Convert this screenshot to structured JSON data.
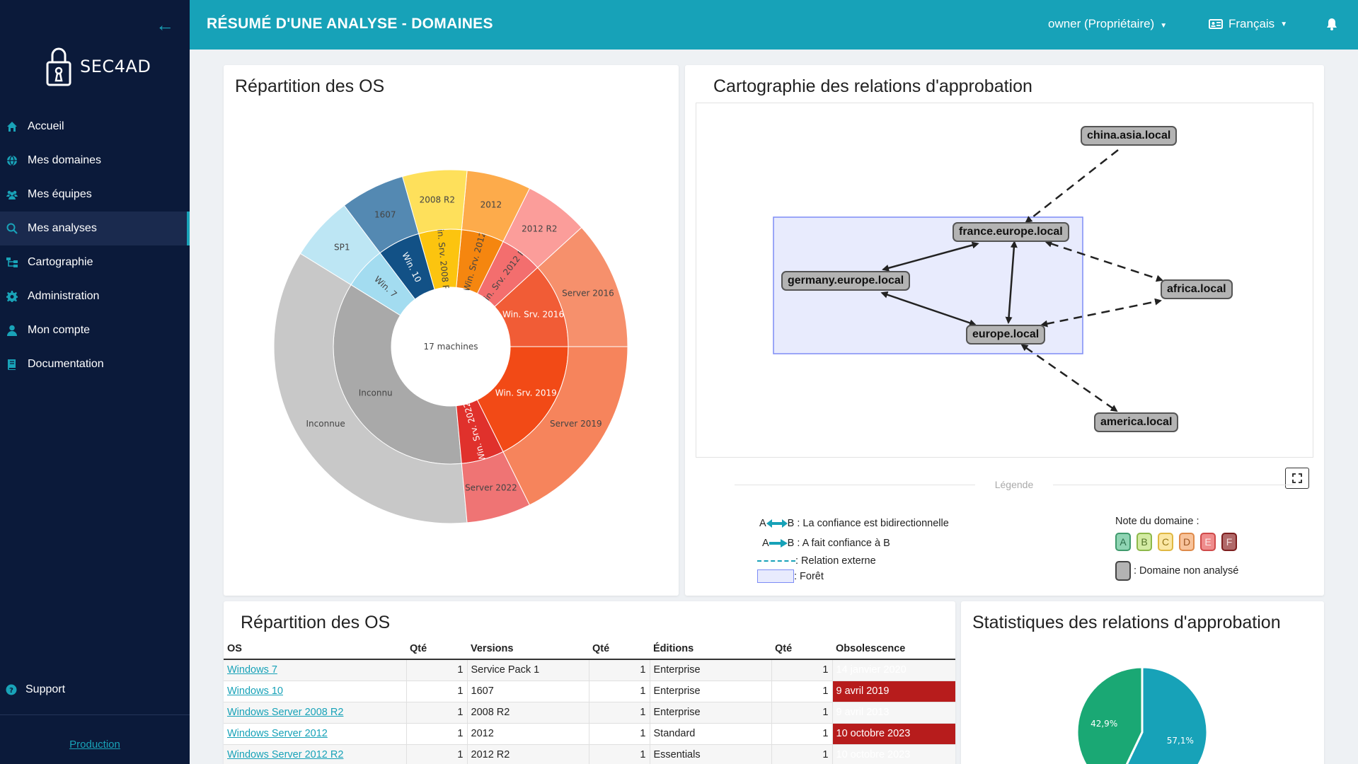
{
  "app": {
    "brand": "SEC4AD",
    "page_title": "RÉSUMÉ D'UNE ANALYSE - DOMAINES",
    "user_menu": "owner (Propriétaire)",
    "language": "Français"
  },
  "sidebar": {
    "items": [
      {
        "label": "Accueil",
        "icon": "home-icon"
      },
      {
        "label": "Mes domaines",
        "icon": "globe-icon"
      },
      {
        "label": "Mes équipes",
        "icon": "users-icon"
      },
      {
        "label": "Mes analyses",
        "icon": "search-icon"
      },
      {
        "label": "Cartographie",
        "icon": "sitemap-icon"
      },
      {
        "label": "Administration",
        "icon": "gear-icon"
      },
      {
        "label": "Mon compte",
        "icon": "user-icon"
      },
      {
        "label": "Documentation",
        "icon": "book-icon"
      }
    ],
    "active_index": 3,
    "support": "Support",
    "environment": "Production"
  },
  "os_chart": {
    "title": "Répartition des OS",
    "center_label": "17 machines",
    "chart_data": {
      "type": "sunburst",
      "total": 17,
      "inner": [
        {
          "label": "Win. Srv. 2016",
          "value": 2,
          "color": "#f15c36"
        },
        {
          "label": "Win. Srv. 2012 R2",
          "value": 1,
          "color": "#f36e6e"
        },
        {
          "label": "Win. Srv. 2012",
          "value": 1,
          "color": "#f5860f"
        },
        {
          "label": "Win. Srv. 2008 R2",
          "value": 1,
          "color": "#fcc40f"
        },
        {
          "label": "Win. 10",
          "value": 1,
          "color": "#125186"
        },
        {
          "label": "Win. 7",
          "value": 1,
          "color": "#a3dcf0"
        },
        {
          "label": "Inconnu",
          "value": 6,
          "color": "#a9a9a9"
        },
        {
          "label": "Win. Srv. 2022",
          "value": 1,
          "color": "#e0312c"
        },
        {
          "label": "Win. Srv. 2019",
          "value": 3,
          "color": "#f24a16"
        }
      ],
      "outer": [
        {
          "label": "Server 2016",
          "value": 2,
          "color": "#f6906c"
        },
        {
          "label": "2012 R2",
          "value": 1,
          "color": "#fb9d9a"
        },
        {
          "label": "2012",
          "value": 1,
          "color": "#fdab4b"
        },
        {
          "label": "2008 R2",
          "value": 1,
          "color": "#fee05b"
        },
        {
          "label": "1607",
          "value": 1,
          "color": "#5489b2"
        },
        {
          "label": "SP1",
          "value": 1,
          "color": "#bde6f4"
        },
        {
          "label": "Inconnue",
          "value": 6,
          "color": "#c8c8c8"
        },
        {
          "label": "Server 2022",
          "value": 1,
          "color": "#ef7474"
        },
        {
          "label": "Server 2019",
          "value": 3,
          "color": "#f6845c"
        }
      ]
    }
  },
  "map": {
    "title": "Cartographie des relations d'approbation",
    "nodes": {
      "china": "china.asia.local",
      "france": "france.europe.local",
      "germany": "germany.europe.local",
      "europe": "europe.local",
      "africa": "africa.local",
      "america": "america.local"
    },
    "legend": {
      "title": "Légende",
      "bidir": "B : La confiance est bidirectionnelle",
      "trust": "B : A fait confiance à B",
      "external": ": Relation externe",
      "forest": ": Forêt",
      "grade_title": "Note du domaine :",
      "grades": [
        "A",
        "B",
        "C",
        "D",
        "E",
        "F"
      ],
      "not_analyzed": ": Domaine non analysé",
      "a_letter": "A"
    }
  },
  "os_table": {
    "title": "Répartition des OS",
    "headers": [
      "OS",
      "Qté",
      "Versions",
      "Qté",
      "Éditions",
      "Qté",
      "Obsolescence"
    ],
    "rows": [
      [
        "Windows 7",
        "1",
        "Service Pack 1",
        "1",
        "Enterprise",
        "1",
        "14 janvier 2020"
      ],
      [
        "Windows 10",
        "1",
        "1607",
        "1",
        "Enterprise",
        "1",
        "9 avril 2019"
      ],
      [
        "Windows Server 2008 R2",
        "1",
        "2008 R2",
        "1",
        "Enterprise",
        "1",
        "9 avril 2013"
      ],
      [
        "Windows Server 2012",
        "1",
        "2012",
        "1",
        "Standard",
        "1",
        "10 octobre 2023"
      ],
      [
        "Windows Server 2012 R2",
        "1",
        "2012 R2",
        "1",
        "Essentials",
        "1",
        "10 octobre 2023"
      ]
    ]
  },
  "stats": {
    "title": "Statistiques des relations d'approbation",
    "chart_data": {
      "type": "pie",
      "slices": [
        {
          "label": "57,1%",
          "value": 57.1,
          "color": "#17a2b8"
        },
        {
          "label": "42,9%",
          "value": 42.9,
          "color": "#1aa874"
        }
      ]
    }
  }
}
